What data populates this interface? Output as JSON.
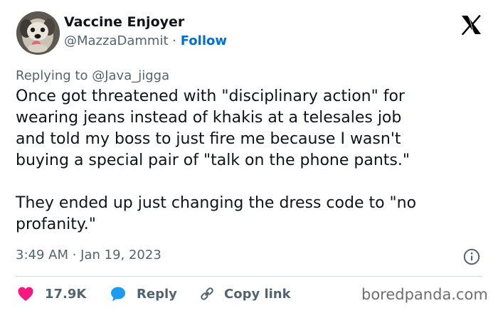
{
  "author": {
    "name": "Vaccine Enjoyer",
    "handle": "@MazzaDammit",
    "separator": "·",
    "follow_label": "Follow"
  },
  "reply": {
    "prefix": "Replying to",
    "to_handle": "@Java_jigga"
  },
  "tweet": {
    "text": "Once got threatened with \"disciplinary action\" for\nwearing jeans instead of khakis at a telesales job\nand told my boss to just fire me because I wasn't\nbuying a special pair of \"talk on the phone pants.\"\n\nThey ended up just changing the dress code to \"no\nprofanity.\"",
    "time": "3:49 AM · Jan 19, 2023"
  },
  "actions": {
    "likes": "17.9K",
    "reply_label": "Reply",
    "copy_label": "Copy link"
  },
  "icons": {
    "brand": "x-logo-icon",
    "info": "info-icon",
    "like": "heart-icon",
    "reply": "speech-bubble-icon",
    "copy": "link-icon"
  },
  "colors": {
    "like": "#f91880",
    "reply": "#1d9bf0",
    "follow": "#006fd6",
    "secondary_text": "#536471"
  },
  "watermark": "boredpanda.com"
}
